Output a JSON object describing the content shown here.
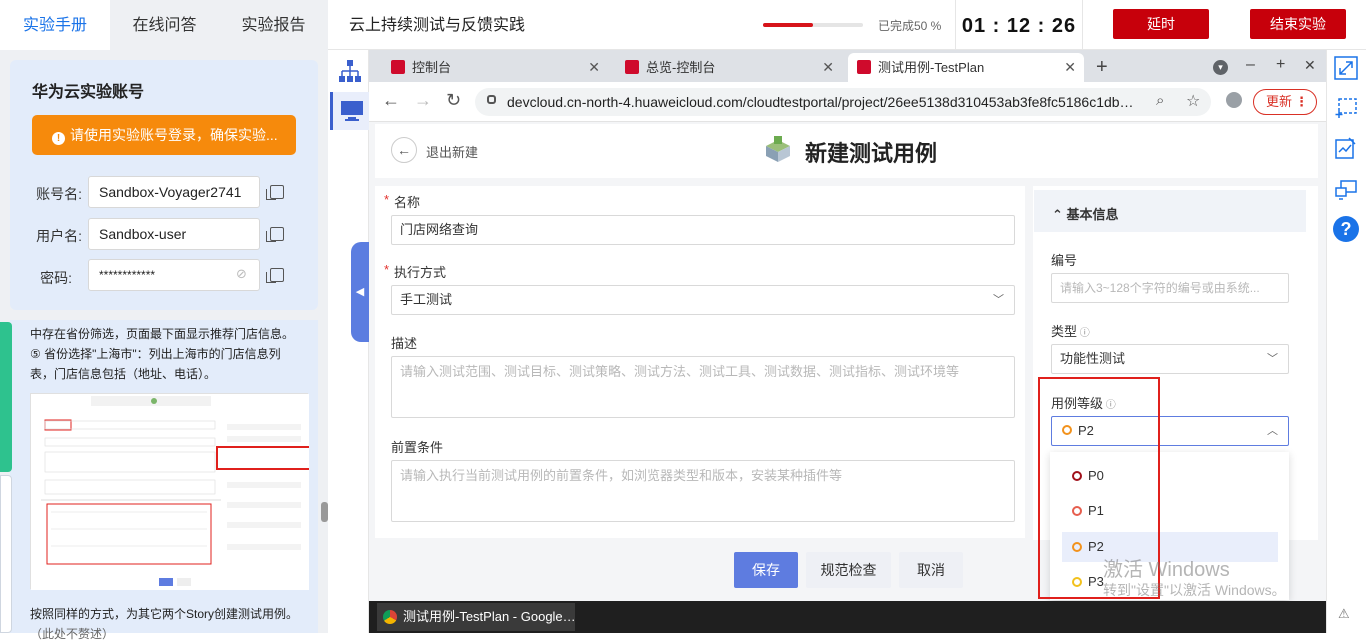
{
  "topbar": {
    "tabs": [
      "实验手册",
      "在线问答",
      "实验报告"
    ],
    "course_title": "云上持续测试与反馈实践",
    "progress_text": "已完成50 %",
    "progress_value": 0.5,
    "timer": "01 : 12 : 26",
    "extend_label": "延时",
    "end_label": "结束实验"
  },
  "account": {
    "title": "华为云实验账号",
    "warning": "请使用实验账号登录，确保实验...",
    "account_label": "账号名:",
    "account_value": "Sandbox-Voyager2741",
    "user_label": "用户名:",
    "user_value": "Sandbox-user",
    "password_label": "密码:",
    "password_value": "************"
  },
  "manual": {
    "para1": "中存在省份筛选，页面最下面显示推荐门店信息。",
    "para2": "⑤ 省份选择\"上海市\"：列出上海市的门店信息列表，门店信息包括（地址、电话）。",
    "para3": "按照同样的方式，为其它两个Story创建测试用例。",
    "para4": "（此处不赘述）"
  },
  "browser": {
    "tabs": [
      "控制台",
      "总览-控制台",
      "测试用例-TestPlan"
    ],
    "url": "devcloud.cn-north-4.huaweicloud.com/cloudtestportal/project/26ee5138d310453ab3fe8fc5186c1db…",
    "refresh_label": "更新"
  },
  "page": {
    "back_label": "退出新建",
    "title": "新建测试用例",
    "name_label": "名称",
    "name_value": "门店网络查询",
    "exec_label": "执行方式",
    "exec_value": "手工测试",
    "desc_label": "描述",
    "desc_placeholder": "请输入测试范围、测试目标、测试策略、测试方法、测试工具、测试数据、测试指标、测试环境等",
    "precond_label": "前置条件",
    "precond_placeholder": "请输入执行当前测试用例的前置条件，如浏览器类型和版本，安装某种插件等",
    "basic_info": "基本信息",
    "id_label": "编号",
    "id_placeholder": "请输入3~128个字符的编号或由系统...",
    "type_label": "类型",
    "type_value": "功能性测试",
    "level_label": "用例等级",
    "level_value": "P2",
    "level_options": [
      "P0",
      "P1",
      "P2",
      "P3"
    ],
    "save_label": "保存",
    "check_label": "规范检查",
    "cancel_label": "取消"
  },
  "watermark": {
    "line1": "激活 Windows",
    "line2": "转到\"设置\"以激活 Windows。"
  },
  "taskbar": {
    "item": "测试用例-TestPlan - Google…"
  },
  "colors": {
    "brand_red": "#c7000b",
    "accent_blue": "#5e7ce0",
    "warning_orange": "#f68a0c"
  }
}
